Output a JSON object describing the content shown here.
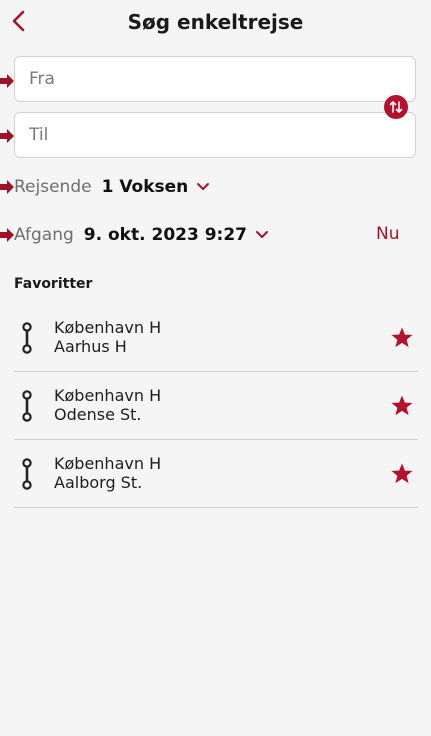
{
  "header": {
    "title": "Søg enkeltrejse",
    "back_icon": "chevron-left-icon"
  },
  "search": {
    "from_placeholder": "Fra",
    "to_placeholder": "Til",
    "swap_icon": "swap-icon"
  },
  "travellers": {
    "label": "Rejsende",
    "value": "1 Voksen"
  },
  "departure": {
    "label": "Afgang",
    "value": "9. okt. 2023 9:27",
    "now_label": "Nu"
  },
  "favorites": {
    "heading": "Favoritter",
    "items": [
      {
        "from": "København H",
        "to": "Aarhus H"
      },
      {
        "from": "København H",
        "to": "Odense St."
      },
      {
        "from": "København H",
        "to": "Aalborg St."
      }
    ]
  },
  "colors": {
    "accent": "#b2122c",
    "background": "#f5f5f5",
    "marker": "#9c1428"
  }
}
